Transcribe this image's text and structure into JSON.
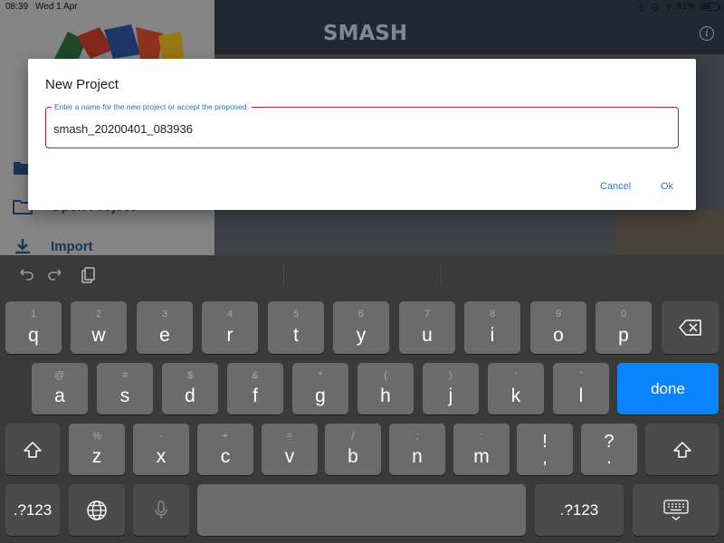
{
  "status_bar": {
    "time": "08:39",
    "date": "Wed 1 Apr",
    "battery": "61%",
    "battery_level": 0.61
  },
  "background_app": {
    "logo_text": "SMASH",
    "menu": [
      {
        "label": "Open Project"
      },
      {
        "label": "Import"
      }
    ]
  },
  "dialog": {
    "title": "New Project",
    "field_label": "Enter a name for the new project or accept the proposed.",
    "field_value": "smash_20200401_083936",
    "cancel_label": "Cancel",
    "ok_label": "Ok"
  },
  "keyboard": {
    "row1": [
      {
        "hint": "1",
        "main": "q"
      },
      {
        "hint": "2",
        "main": "w"
      },
      {
        "hint": "3",
        "main": "e"
      },
      {
        "hint": "4",
        "main": "r"
      },
      {
        "hint": "5",
        "main": "t"
      },
      {
        "hint": "6",
        "main": "y"
      },
      {
        "hint": "7",
        "main": "u"
      },
      {
        "hint": "8",
        "main": "i"
      },
      {
        "hint": "9",
        "main": "o"
      },
      {
        "hint": "0",
        "main": "p"
      }
    ],
    "row2": [
      {
        "hint": "@",
        "main": "a"
      },
      {
        "hint": "#",
        "main": "s"
      },
      {
        "hint": "$",
        "main": "d"
      },
      {
        "hint": "&",
        "main": "f"
      },
      {
        "hint": "*",
        "main": "g"
      },
      {
        "hint": "(",
        "main": "h"
      },
      {
        "hint": ")",
        "main": "j"
      },
      {
        "hint": "’",
        "main": "k"
      },
      {
        "hint": "”",
        "main": "l"
      }
    ],
    "row3": [
      {
        "hint": "%",
        "main": "z"
      },
      {
        "hint": "-",
        "main": "x"
      },
      {
        "hint": "+",
        "main": "c"
      },
      {
        "hint": "=",
        "main": "v"
      },
      {
        "hint": "/",
        "main": "b"
      },
      {
        "hint": ";",
        "main": "n"
      },
      {
        "hint": ":",
        "main": "m"
      }
    ],
    "punct1": {
      "top": "!",
      "bottom": ","
    },
    "punct2": {
      "top": "?",
      "bottom": "."
    },
    "done_label": "done",
    "numbers_label": ".?123",
    "colors": {
      "key": "#6b6b6b",
      "dark_key": "#4b4b4b",
      "accent": "#0a84ff",
      "field_border": "#b4232b",
      "link": "#2a78c4"
    }
  }
}
